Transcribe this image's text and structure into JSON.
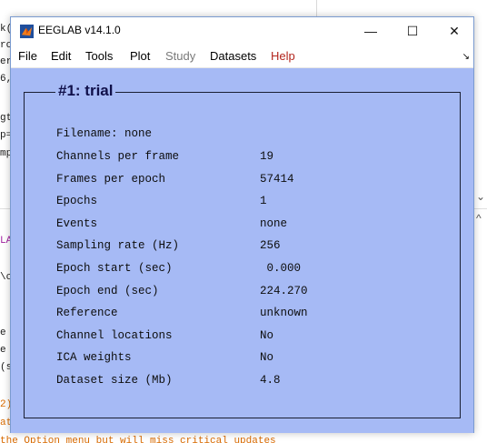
{
  "window": {
    "title": "EEGLAB v14.1.0",
    "minimize_glyph": "—",
    "maximize_glyph": "☐",
    "close_glyph": "✕"
  },
  "menu": {
    "items": [
      {
        "label": "File",
        "state": "enabled"
      },
      {
        "label": "Edit",
        "state": "enabled"
      },
      {
        "label": "Tools",
        "state": "enabled"
      },
      {
        "label": "Plot",
        "state": "enabled"
      },
      {
        "label": "Study",
        "state": "disabled"
      },
      {
        "label": "Datasets",
        "state": "enabled"
      },
      {
        "label": "Help",
        "state": "highlight"
      }
    ],
    "overflow_glyph": "↘"
  },
  "panel": {
    "title": "#1: trial",
    "filename_line": "Filename: none",
    "rows": [
      {
        "label": "Channels per frame",
        "value": "19"
      },
      {
        "label": "Frames per epoch",
        "value": "57414"
      },
      {
        "label": "Epochs",
        "value": "1"
      },
      {
        "label": "Events",
        "value": "none"
      },
      {
        "label": "Sampling rate (Hz)",
        "value": "256"
      },
      {
        "label": "Epoch start (sec)",
        "value": " 0.000"
      },
      {
        "label": "Epoch end (sec)",
        "value": "224.270"
      },
      {
        "label": "Reference",
        "value": "unknown"
      },
      {
        "label": "Channel locations",
        "value": "No"
      },
      {
        "label": "ICA weights",
        "value": "No"
      },
      {
        "label": "Dataset size (Mb)",
        "value": "4.8"
      }
    ]
  },
  "background": {
    "lines_left": [
      "k(",
      "ro",
      "er",
      "6,",
      "",
      "gt",
      "p=",
      "mp"
    ],
    "pink_line": "LA",
    "path_line": "\\c",
    "lines_lower": [
      "e",
      "e",
      "(s"
    ],
    "orange_lines": [
      "2)",
      "at"
    ],
    "bottom_line": "the Option menu but will miss critical updates",
    "scroll_down_glyph": "⌄",
    "scroll_up_glyph": "^"
  },
  "colors": {
    "client_bg": "#a6baf5",
    "panel_title": "#10104a",
    "help_menu": "#b3261e"
  }
}
